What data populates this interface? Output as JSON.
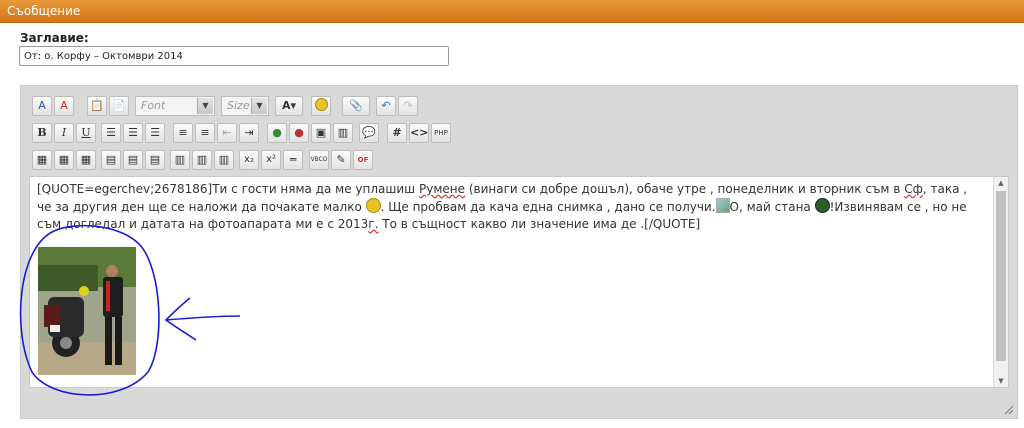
{
  "header": {
    "title": "Съобщение"
  },
  "title_field": {
    "label": "Заглавие:",
    "value": "От: о. Корфу – Октомври 2014"
  },
  "toolbar": {
    "font_placeholder": "Font",
    "size_placeholder": "Size",
    "bold": "B",
    "italic": "I",
    "underline": "U",
    "hash": "#",
    "code": "<>",
    "subscript": "x₂",
    "superscript": "x²"
  },
  "message": {
    "part1": "[QUOTE=egerchev;2678186]Ти с гости няма да ме уплашиш ",
    "word_rumene": "Румене",
    "part2": " (винаги си добре дошъл), обаче утре , понеделник и вторник съм в ",
    "word_sf": "Сф",
    "part3": ", така , че за другия ден ще се наложи да почакате малко ",
    "part4": ". Ще пробвам да кача една снимка , дано се получи.",
    "part5": "О, май стана ",
    "part6": "!Извинявам се , но не съм догледал и датата на фотоапарата ми е с 2013",
    "word_g": "г.",
    "part7": " То в същност какво ли значение има де .[/QUOTE]"
  },
  "colors": {
    "header_orange": "#d67716",
    "annotation_blue": "#1a1ad6"
  }
}
